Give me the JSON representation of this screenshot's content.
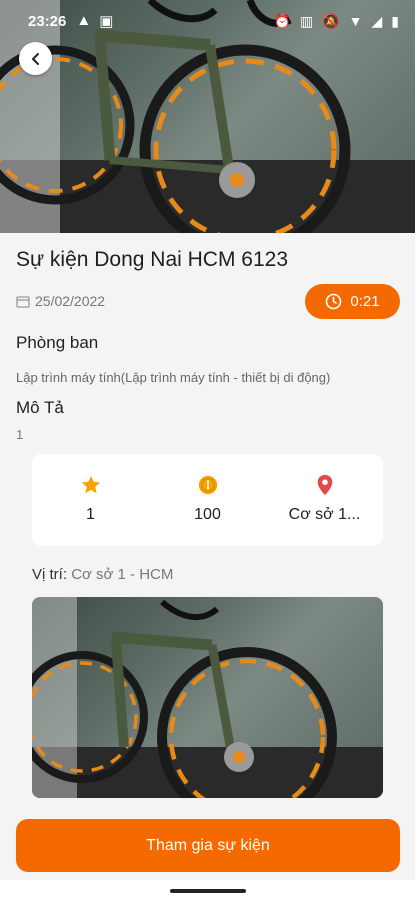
{
  "status_bar": {
    "time": "23:26",
    "left_icons": [
      "alert-icon",
      "clipboard-icon"
    ],
    "right_icons": [
      "alarm-icon",
      "vibrate-icon",
      "mute-icon",
      "wifi-icon",
      "signal-icon",
      "battery-icon"
    ]
  },
  "event": {
    "title": "Sự kiện Dong Nai HCM 6123",
    "date": "25/02/2022",
    "timer": "0:21",
    "department_label": "Phòng ban",
    "department_value": "Lập trình máy tính(Lập trình máy tính - thiết bị di động)",
    "description_label": "Mô Tả",
    "description_value": "1"
  },
  "stats": {
    "stars": "1",
    "coins": "100",
    "place": "Cơ sở 1..."
  },
  "location": {
    "label": "Vị trí:",
    "value": "Cơ sở 1 - HCM"
  },
  "actions": {
    "join_label": "Tham gia sự kiện"
  },
  "colors": {
    "accent": "#f56a00",
    "star": "#f5a300",
    "coin": "#f5a300",
    "pin": "#e34a4a"
  }
}
